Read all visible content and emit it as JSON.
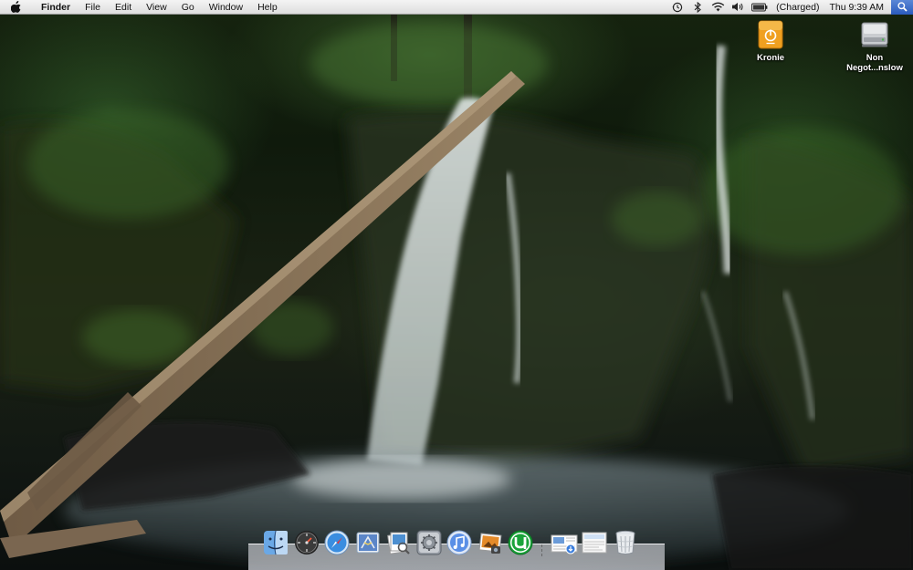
{
  "menubar": {
    "apple_icon": "apple-icon",
    "items": [
      "Finder",
      "File",
      "Edit",
      "View",
      "Go",
      "Window",
      "Help"
    ],
    "status_icons": [
      "time-machine-icon",
      "bluetooth-icon",
      "wifi-icon",
      "volume-icon",
      "battery-icon"
    ],
    "battery_status": "(Charged)",
    "clock": "Thu 9:39 AM",
    "spotlight_icon": "spotlight-icon"
  },
  "desktop_icons": [
    {
      "label": "Kronie",
      "icon": "external-drive-icon",
      "color": "#f0a020"
    },
    {
      "label_line1": "Non",
      "label_line2": "Negot...nslow",
      "icon": "internal-drive-icon"
    }
  ],
  "dock": {
    "apps": [
      {
        "name": "Finder",
        "icon": "finder-icon"
      },
      {
        "name": "Dashboard",
        "icon": "dashboard-icon"
      },
      {
        "name": "Safari",
        "icon": "safari-icon"
      },
      {
        "name": "Mail",
        "icon": "mail-icon"
      },
      {
        "name": "Preview",
        "icon": "preview-icon"
      },
      {
        "name": "System Preferences",
        "icon": "system-preferences-icon"
      },
      {
        "name": "iTunes",
        "icon": "itunes-icon"
      },
      {
        "name": "iPhoto",
        "icon": "iphoto-icon"
      },
      {
        "name": "uTorrent",
        "icon": "utorrent-icon"
      }
    ],
    "stacks": [
      {
        "name": "Downloads",
        "icon": "downloads-stack-icon"
      },
      {
        "name": "Documents",
        "icon": "documents-stack-icon"
      },
      {
        "name": "Trash",
        "icon": "trash-icon"
      }
    ]
  },
  "colors": {
    "menubar_bg": "#e8e8e8",
    "utorrent_green": "#1aa33a",
    "kronie_orange": "#f0a020",
    "spotlight_blue": "#2a5bbd"
  }
}
